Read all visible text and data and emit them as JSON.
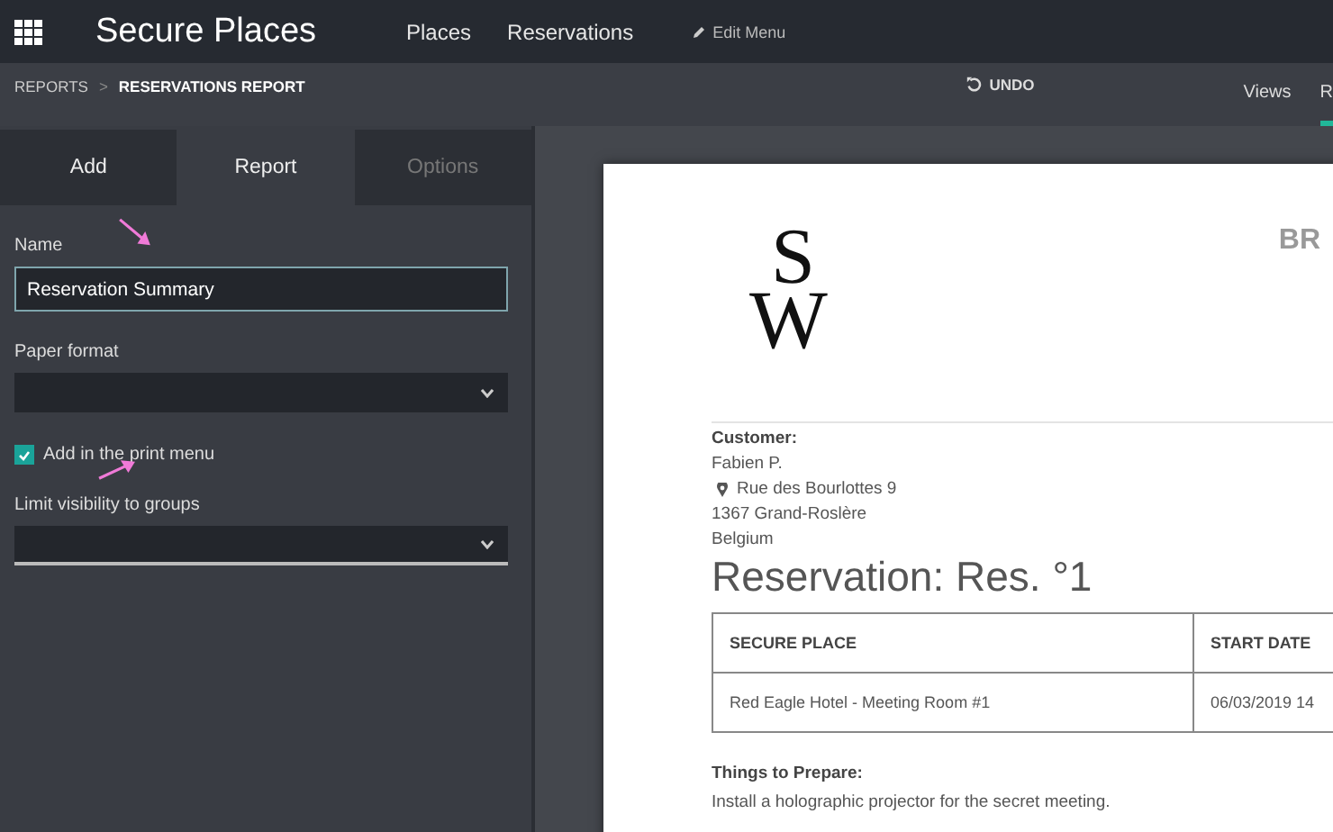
{
  "app": {
    "title": "Secure Places",
    "menu": [
      {
        "label": "Places"
      },
      {
        "label": "Reservations"
      }
    ],
    "edit_menu": "Edit Menu"
  },
  "breadcrumb": {
    "items": [
      "REPORTS",
      "RESERVATIONS REPORT"
    ],
    "separator": ">"
  },
  "toolbar": {
    "undo": "UNDO",
    "tabs": [
      {
        "label": "Views",
        "selected": false
      },
      {
        "label": "R",
        "selected": true
      }
    ]
  },
  "sidebar": {
    "tabs": [
      {
        "label": "Add",
        "selected": false
      },
      {
        "label": "Report",
        "selected": true
      },
      {
        "label": "Options",
        "selected": false
      }
    ],
    "fields": [
      {
        "kind": "text",
        "label": "Name",
        "value": "Reservation Summary"
      },
      {
        "kind": "select",
        "label": "Paper format"
      },
      {
        "kind": "checkbox",
        "label": "Add in the print menu",
        "checked": true
      },
      {
        "kind": "tags",
        "label": "Limit visibility to groups"
      }
    ]
  },
  "report": {
    "logo": [
      "S",
      "W"
    ],
    "company": "BR",
    "customer_label": "Customer:",
    "customer": {
      "name": "Fabien P.",
      "street": "Rue des Bourlottes 9",
      "city": "1367 Grand-Roslère",
      "country": "Belgium"
    },
    "heading": "Reservation: Res. °1",
    "table": {
      "columns": [
        "SECURE PLACE",
        "START DATE"
      ],
      "rows": [
        [
          "Red Eagle Hotel - Meeting Room #1",
          "06/03/2019 14"
        ]
      ]
    },
    "notes_label": "Things to Prepare:",
    "notes": "Install a holographic projector for the secret meeting."
  }
}
